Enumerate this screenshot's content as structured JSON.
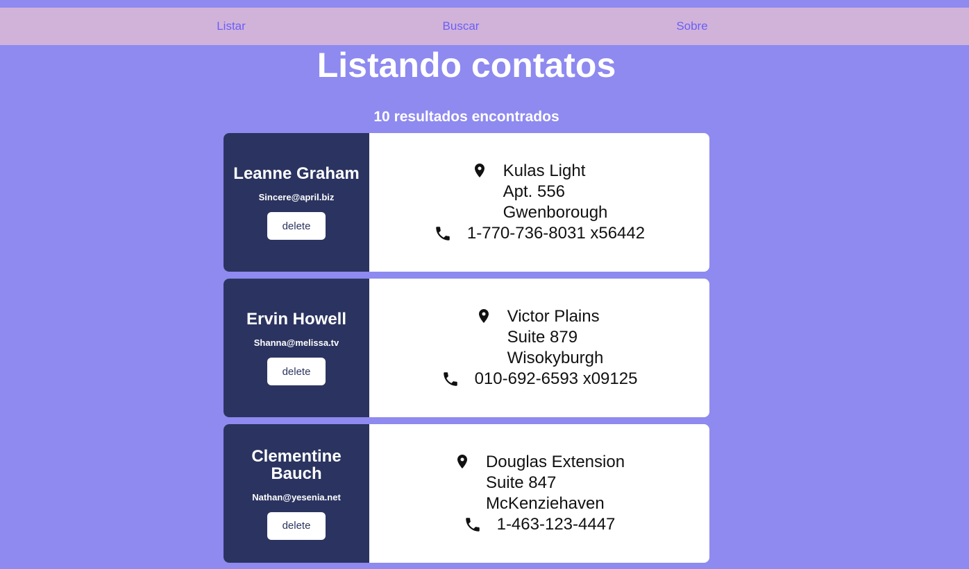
{
  "nav": {
    "items": [
      {
        "label": "Listar"
      },
      {
        "label": "Buscar"
      },
      {
        "label": "Sobre"
      }
    ]
  },
  "page": {
    "title": "Listando contatos",
    "results_text": "10 resultados encontrados"
  },
  "contacts": [
    {
      "name": "Leanne Graham",
      "email": "Sincere@april.biz",
      "delete_label": "delete",
      "street": "Kulas Light",
      "suite": "Apt. 556",
      "city": "Gwenborough",
      "phone": "1-770-736-8031 x56442"
    },
    {
      "name": "Ervin Howell",
      "email": "Shanna@melissa.tv",
      "delete_label": "delete",
      "street": "Victor Plains",
      "suite": "Suite 879",
      "city": "Wisokyburgh",
      "phone": "010-692-6593 x09125"
    },
    {
      "name": "Clementine Bauch",
      "email": "Nathan@yesenia.net",
      "delete_label": "delete",
      "street": "Douglas Extension",
      "suite": "Suite 847",
      "city": "McKenziehaven",
      "phone": "1-463-123-4447"
    }
  ],
  "colors": {
    "background": "#8e8af0",
    "nav_background": "#d1b3da",
    "nav_link": "#6a5ff5",
    "card_left": "#2b3460",
    "card_right": "#ffffff"
  },
  "icons": {
    "address": "map-pin-icon",
    "phone": "phone-icon"
  }
}
